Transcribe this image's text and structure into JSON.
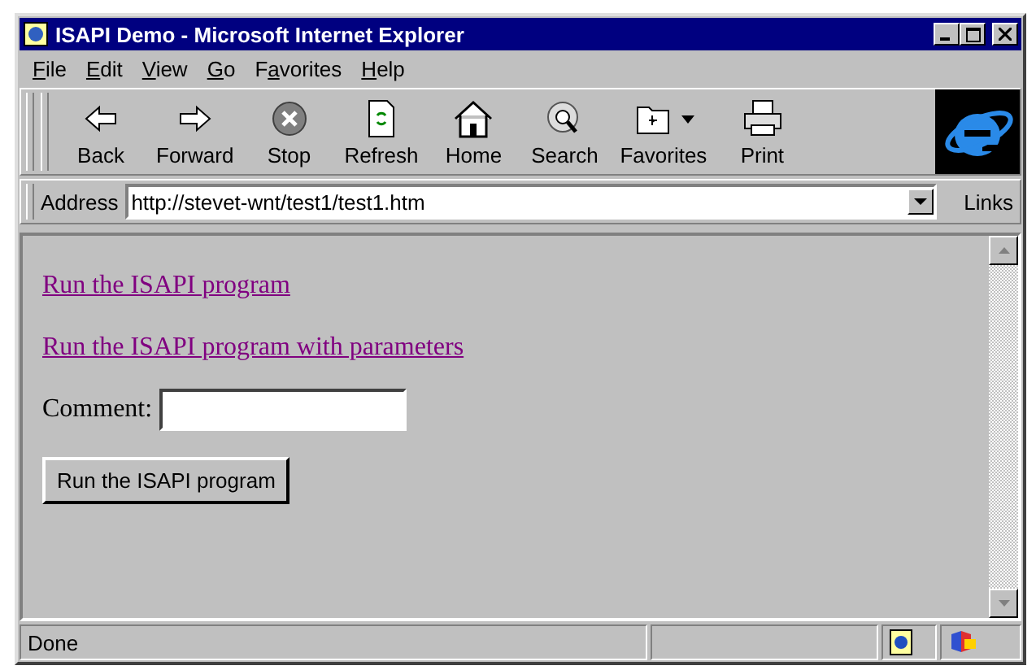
{
  "window": {
    "title": "ISAPI Demo - Microsoft Internet Explorer"
  },
  "menu": [
    {
      "accel": "F",
      "after": "ile"
    },
    {
      "accel": "E",
      "after": "dit"
    },
    {
      "accel": "V",
      "after": "iew"
    },
    {
      "accel": "G",
      "after": "o"
    },
    {
      "before": "F",
      "accel": "a",
      "after": "vorites"
    },
    {
      "accel": "H",
      "after": "elp"
    }
  ],
  "toolbar": [
    {
      "label": "Back",
      "dropdown": false
    },
    {
      "label": "Forward",
      "dropdown": false
    },
    {
      "label": "Stop",
      "dropdown": false
    },
    {
      "label": "Refresh",
      "dropdown": false
    },
    {
      "label": "Home",
      "dropdown": false
    },
    {
      "label": "Search",
      "dropdown": false
    },
    {
      "label": "Favorites",
      "dropdown": true
    },
    {
      "label": "Print",
      "dropdown": false
    }
  ],
  "address": {
    "label": "Address",
    "value": "http://stevet-wnt/test1/test1.htm",
    "links": "Links"
  },
  "page": {
    "links": [
      {
        "text": "Run the ISAPI program",
        "visited": true
      },
      {
        "text": "Run the ISAPI program with parameters",
        "visited": true
      }
    ],
    "comment_label": "Comment:",
    "button": "Run the ISAPI program"
  },
  "status_bar": {
    "text": "Done"
  }
}
